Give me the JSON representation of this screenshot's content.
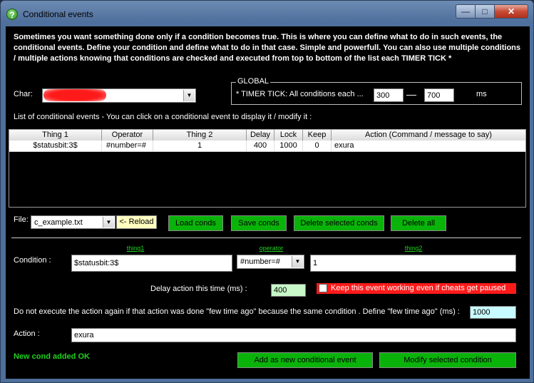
{
  "window": {
    "title": "Conditional events",
    "title_icon": "?",
    "min_glyph": "—",
    "max_glyph": "□",
    "close_glyph": "✕"
  },
  "intro": "Sometimes you want something done only if a condition becomes true. This is where you can define what to do in such events, the conditional events. Define your condition and define what to do in that case. Simple and powerfull. You can also use multiple conditions / multiple actions knowing that conditions are checked and executed from top to bottom of the list each TIMER TICK *",
  "char": {
    "label": "Char:",
    "value": ""
  },
  "global": {
    "title": "GLOBAL",
    "timer_label": "* TIMER TICK: All conditions each ...",
    "min": "300",
    "dash": "—",
    "max": "700",
    "unit": "ms"
  },
  "list": {
    "caption": "List of conditional events - You can click on a conditional event to display it / modify it :",
    "columns": [
      "Thing 1",
      "Operator",
      "Thing 2",
      "Delay",
      "Lock",
      "Keep",
      "Action (Command / message to say)"
    ],
    "rows": [
      [
        "$statusbit:3$",
        "#number=#",
        "1",
        "400",
        "1000",
        "0",
        "exura"
      ]
    ]
  },
  "file": {
    "label": "File:",
    "value": "c_example.txt",
    "reload": "<- Reload"
  },
  "buttons": {
    "load": "Load conds",
    "save": "Save conds",
    "delete_selected": "Delete selected conds",
    "delete_all": "Delete all",
    "add_new": "Add as new conditional event",
    "modify": "Modify selected condition"
  },
  "editor": {
    "thing1_header": "thing1",
    "operator_header": "operator",
    "thing2_header": "thing2",
    "condition_label": "Condition :",
    "thing1_value": "$statusbit:3$",
    "operator_value": "#number=#",
    "thing2_value": "1",
    "delay_label": "Delay action this time (ms) :",
    "delay_value": "400",
    "keep_label": "Keep this event working even if cheats get paused",
    "keep_checked": false,
    "lock_label": "Do not execute the action again if that action was done \"few time ago\" because the same condition . Define \"few time ago\" (ms) :",
    "lock_value": "1000",
    "action_label": "Action :",
    "action_value": "exura",
    "status": "New cond added OK"
  },
  "colors": {
    "button_green": "#0ab30a",
    "status_green": "#1fd11f",
    "delay_bg": "#c8f7c8",
    "lock_bg": "#c8fbff",
    "keep_bg": "#ff1a1a"
  }
}
